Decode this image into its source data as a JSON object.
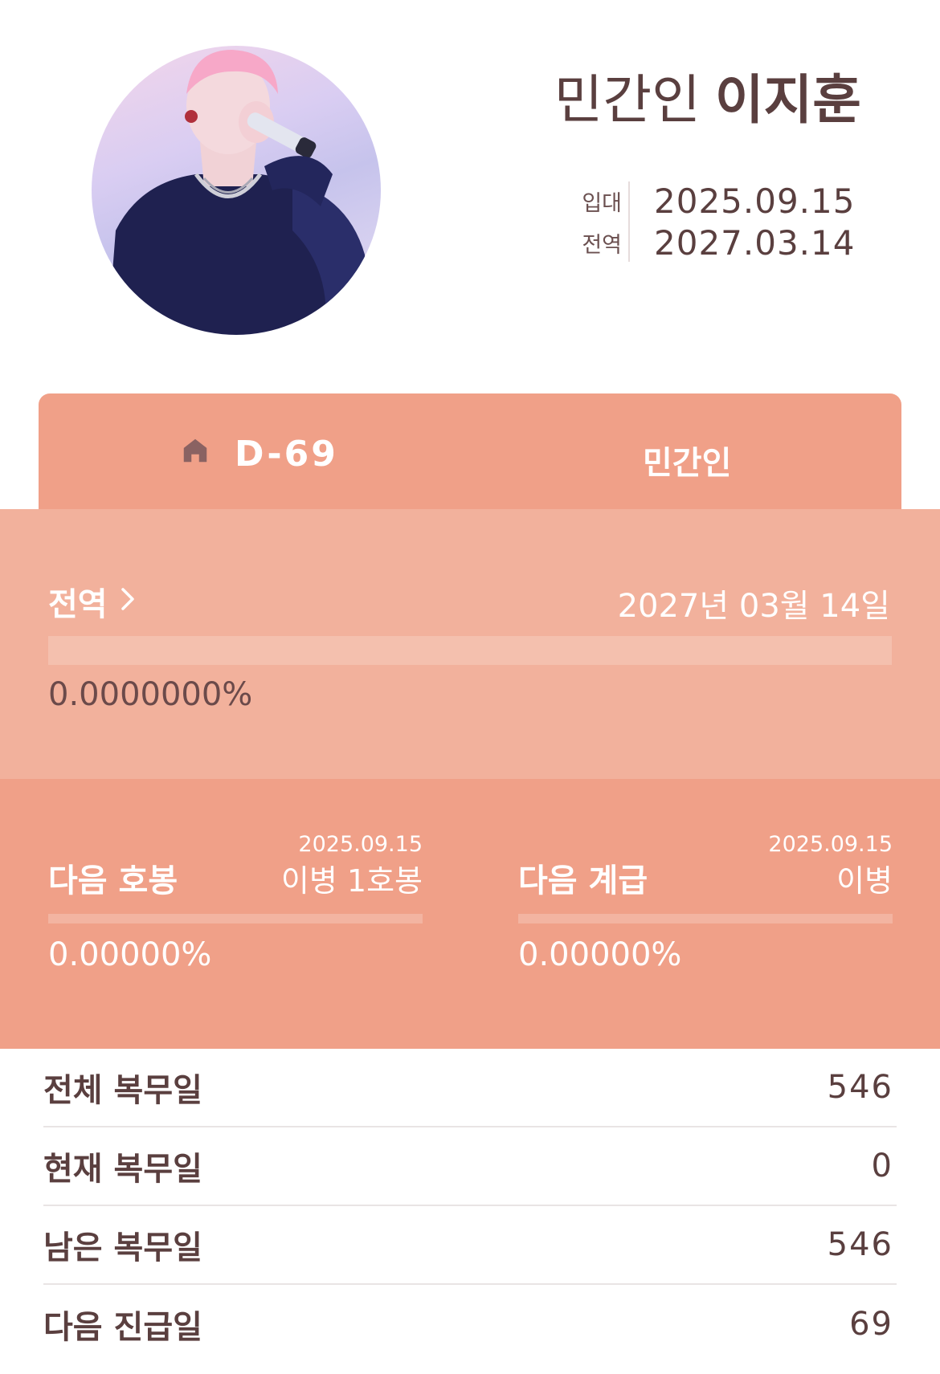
{
  "profile": {
    "status_prefix": "민간인",
    "name": "이지훈",
    "enlist_label": "입대",
    "enlist_date": "2025.09.15",
    "discharge_label": "전역",
    "discharge_date": "2027.03.14"
  },
  "tabs": {
    "dday": "D-69",
    "status": "민간인",
    "icon": "home-icon"
  },
  "discharge": {
    "title": "전역",
    "date_full": "2027년 03월 14일",
    "percent_text": "0.0000000%",
    "progress": 0.0
  },
  "next_pay": {
    "label": "다음 호봉",
    "date": "2025.09.15",
    "rank": "이병 1호봉",
    "percent_text": "0.00000%",
    "progress": 0.0
  },
  "next_rank": {
    "label": "다음 계급",
    "date": "2025.09.15",
    "rank": "이병",
    "percent_text": "0.00000%",
    "progress": 0.0
  },
  "stats": [
    {
      "label": "전체 복무일",
      "value": "546"
    },
    {
      "label": "현재 복무일",
      "value": "0"
    },
    {
      "label": "남은 복무일",
      "value": "546"
    },
    {
      "label": "다음 진급일",
      "value": "69"
    }
  ],
  "colors": {
    "accent": "#f0a088",
    "accent_light": "#f2b19c",
    "text_dark": "#5a3f3f"
  }
}
